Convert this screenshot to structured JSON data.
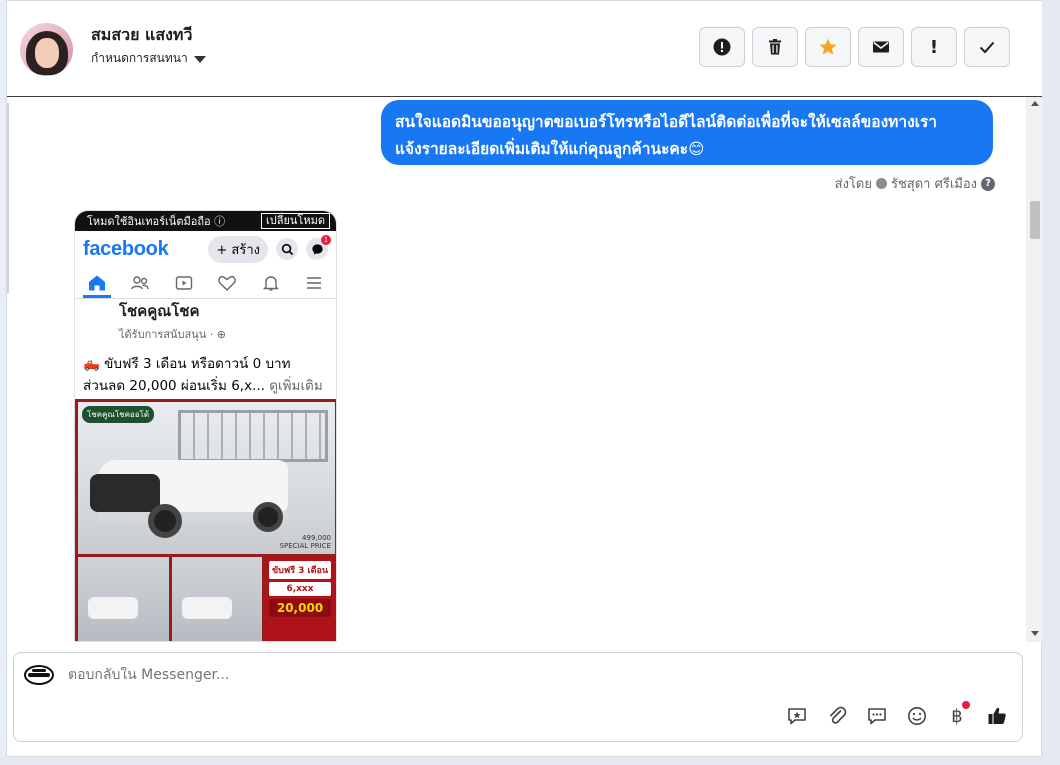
{
  "header": {
    "contact_name": "สมสวย แสงทวี",
    "assign_label": "กำหนดการสนทนา",
    "actions": [
      {
        "name": "report-button",
        "icon": "alert-circle-icon"
      },
      {
        "name": "delete-button",
        "icon": "trash-icon"
      },
      {
        "name": "star-button",
        "icon": "star-icon",
        "color": "#f5a623"
      },
      {
        "name": "mark-unread-button",
        "icon": "envelope-icon"
      },
      {
        "name": "important-button",
        "icon": "exclamation-icon",
        "glyph": "!"
      },
      {
        "name": "done-button",
        "icon": "check-icon"
      }
    ]
  },
  "conversation": {
    "message": {
      "line1": "สนใจแอดมินขออนุญาตขอเบอร์โทรหรือไอดีไลน์ติดต่อเพื่อที่จะให้เซลล์ของทางเรา",
      "line2": "แจ้งรายละเอียดเพิ่มเติมให้แก่คุณลูกค้านะคะ😊",
      "bubble_color": "#1877f2"
    },
    "sent_by_label": "ส่งโดย",
    "sent_by_name": "รัชสุดา ศรีเมือง",
    "help_glyph": "?",
    "attachment": {
      "mode_notice": "โหมดใช้อินเทอร์เน็ตมือถือ ⓘ",
      "switch_mode": "เปลี่ยนโหมด",
      "fb_logo": "facebook",
      "create_label": "+ สร้าง",
      "messenger_badge": "1",
      "page_name": "โชคคูณโชค",
      "sponsored": "ได้รับการสนับสนุน · ⊕",
      "post_line1": "🛻 ขับฟรี 3 เดือน หรือดาวน์ 0 บาท",
      "post_line2": "ส่วนลด 20,000 ผ่อนเริ่ม 6,x...",
      "see_more": "ดูเพิ่มเติม",
      "ad_brand": "โชคคูณโชคออโต้",
      "ad_price": "499,000",
      "ad_price_label": "SPECIAL PRICE",
      "offer_1": "ขับฟรี 3 เดือน",
      "offer_2": "6,xxx",
      "offer_3": "20,000"
    }
  },
  "composer": {
    "avatar_icon": "page-logo-icon",
    "placeholder": "ตอบกลับใน Messenger...",
    "tools": [
      "saved-reply-icon",
      "attachment-icon",
      "quick-reply-icon",
      "emoji-icon",
      "payment-icon",
      "like-icon"
    ],
    "baht_glyph": "฿"
  }
}
